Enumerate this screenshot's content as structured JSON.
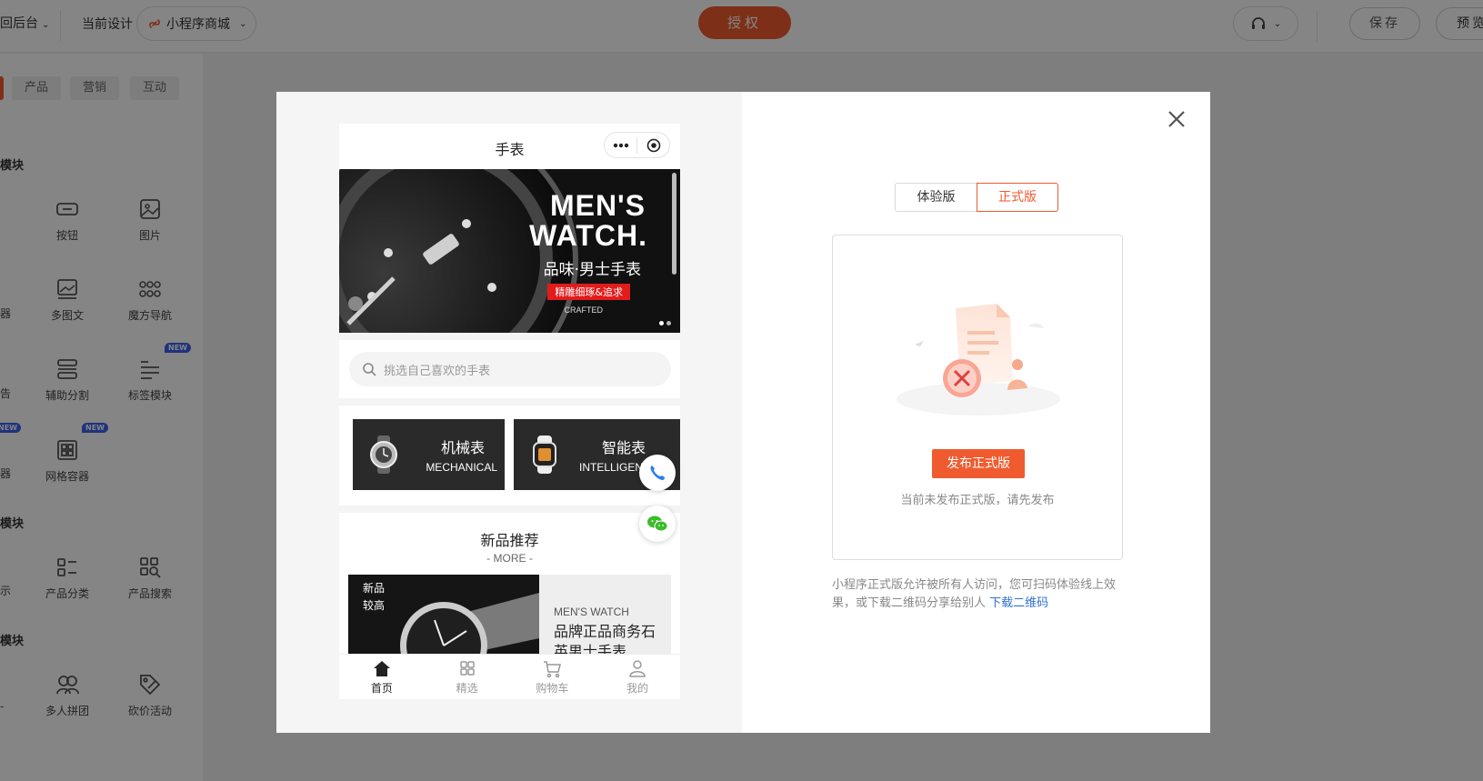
{
  "topbar": {
    "back_label": "回后台",
    "current_design_label": "当前设计",
    "app_name": "小程序商城",
    "auth_label": "授权",
    "save_label": "保存",
    "preview_label": "预览"
  },
  "leftpanel": {
    "tabs": [
      "产品",
      "营销",
      "互动"
    ],
    "sections": [
      "模块",
      "模块",
      "模块"
    ],
    "items": [
      {
        "label": "按钮",
        "icon": "button-icon"
      },
      {
        "label": "图片",
        "icon": "image-icon"
      },
      {
        "label": "多图文",
        "icon": "multi-image-icon"
      },
      {
        "label": "魔方导航",
        "icon": "grid-dots-icon"
      },
      {
        "label": "辅助分割",
        "icon": "divider-icon"
      },
      {
        "label": "标签模块",
        "icon": "tag-list-icon"
      },
      {
        "label": "网格容器",
        "icon": "grid-container-icon"
      },
      {
        "label": "产品分类",
        "icon": "category-icon"
      },
      {
        "label": "产品搜索",
        "icon": "product-search-icon"
      },
      {
        "label": "多人拼团",
        "icon": "group-buy-icon"
      },
      {
        "label": "砍价活动",
        "icon": "bargain-icon"
      }
    ],
    "fragments": [
      "器",
      "告",
      "器",
      "示",
      "-"
    ],
    "new_badge": "NEW"
  },
  "phone": {
    "title": "手表",
    "banner": {
      "title_line1": "MEN'S",
      "title_line2": "WATCH.",
      "subtitle": "品味·男士手表",
      "tag": "精雕细琢&追求",
      "crafted": "CRAFTED"
    },
    "search_placeholder": "挑选自己喜欢的手表",
    "categories": [
      {
        "cn": "机械表",
        "en": "MECHANICAL"
      },
      {
        "cn": "智能表",
        "en": "INTELLIGENT"
      }
    ],
    "new_section": {
      "title": "新品推荐",
      "more": "- MORE -",
      "label_line1": "新品",
      "label_line2": "较高",
      "product_en": "MEN'S WATCH",
      "product_cn": "品牌正品商务石英男士手表"
    },
    "tabs": [
      {
        "label": "首页",
        "icon": "home-icon",
        "active": true
      },
      {
        "label": "精选",
        "icon": "featured-grid-icon",
        "active": false
      },
      {
        "label": "购物车",
        "icon": "cart-icon",
        "active": false
      },
      {
        "label": "我的",
        "icon": "user-icon",
        "active": false
      }
    ]
  },
  "publish": {
    "segment_trial": "体验版",
    "segment_official": "正式版",
    "publish_button": "发布正式版",
    "note": "当前未发布正式版，请先发布",
    "info_text": "小程序正式版允许被所有人访问，您可扫码体验线上效果，或下载二维码分享给别人",
    "download_link": "下载二维码"
  },
  "colors": {
    "accent": "#ef5b2f",
    "link": "#2f6fd6",
    "badge": "#3c62f0"
  }
}
